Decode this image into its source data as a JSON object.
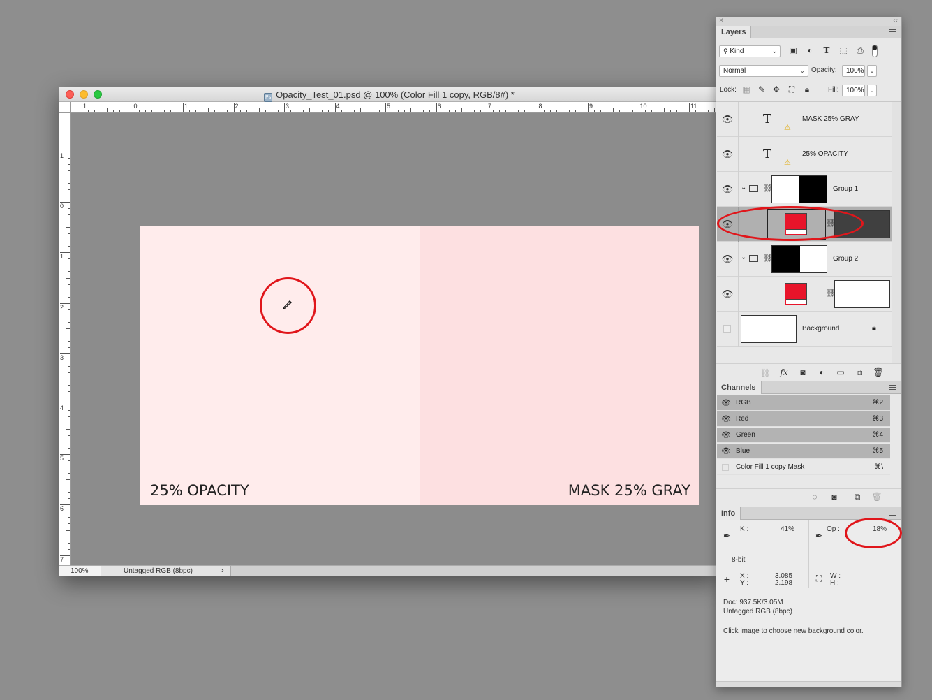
{
  "document": {
    "filename": "Opacity_Test_01.psd @ 100% (Color Fill 1 copy, RGB/8#) *",
    "ps_badge": "Ps",
    "zoom": "100%",
    "color_profile": "Untagged RGB (8bpc)",
    "status_arrow": "›",
    "ruler_h_numbers": [
      "1",
      "0",
      "1",
      "2",
      "3",
      "4",
      "5",
      "6",
      "7",
      "8",
      "9",
      "10",
      "11"
    ],
    "ruler_v_numbers": [
      "1",
      "0",
      "1",
      "2",
      "3",
      "4",
      "5",
      "6",
      "7"
    ],
    "art_left_label": "25% OPACITY",
    "art_right_label": "MASK 25% GRAY",
    "art_left_color": "#ffecec",
    "art_right_color": "#fde0e1"
  },
  "layers_panel": {
    "tab": "Layers",
    "filter_kind": "Kind",
    "blend_mode": "Normal",
    "opacity_label": "Opacity:",
    "opacity_value": "100%",
    "lock_label": "Lock:",
    "fill_label": "Fill:",
    "fill_value": "100%",
    "layers": [
      {
        "name": "MASK 25% GRAY",
        "type": "text"
      },
      {
        "name": "25% OPACITY",
        "type": "text"
      },
      {
        "name": "Group 1",
        "type": "group"
      },
      {
        "name": "",
        "type": "fill",
        "selected": true
      },
      {
        "name": "Group 2",
        "type": "group"
      },
      {
        "name": "",
        "type": "fill"
      },
      {
        "name": "Background",
        "type": "background"
      }
    ]
  },
  "channels_panel": {
    "tab": "Channels",
    "channels": [
      {
        "name": "RGB",
        "shortcut": "⌘2"
      },
      {
        "name": "Red",
        "shortcut": "⌘3"
      },
      {
        "name": "Green",
        "shortcut": "⌘4"
      },
      {
        "name": "Blue",
        "shortcut": "⌘5"
      },
      {
        "name": "Color Fill 1 copy Mask",
        "shortcut": "⌘\\"
      }
    ]
  },
  "info_panel": {
    "tab": "Info",
    "k_label": "K :",
    "k_value": "41%",
    "op_label": "Op :",
    "op_value": "18%",
    "bit_depth": "8-bit",
    "x_label": "X :",
    "y_label": "Y :",
    "x_value": "3.085",
    "y_value": "2.198",
    "w_label": "W :",
    "h_label": "H :",
    "doc_size": "Doc: 937.5K/3.05M",
    "profile": "Untagged RGB (8bpc)",
    "hint": "Click image to choose new background color."
  },
  "colors": {
    "accent_red": "#e0161b",
    "swatch_red": "#e8142a"
  }
}
